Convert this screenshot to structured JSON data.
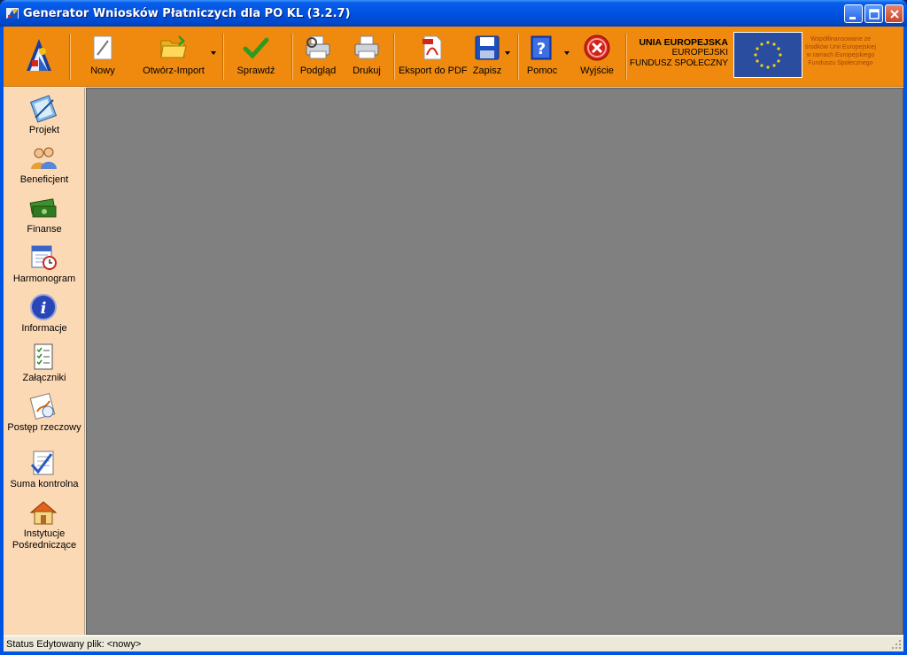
{
  "window": {
    "title": "Generator Wniosków Płatniczych dla PO KL (3.2.7)"
  },
  "toolbar": {
    "new_label": "Nowy",
    "open_label": "Otwórz-Import",
    "check_label": "Sprawdź",
    "preview_label": "Podgląd",
    "print_label": "Drukuj",
    "pdf_label": "Eksport do PDF",
    "save_label": "Zapisz",
    "help_label": "Pomoc",
    "exit_label": "Wyjście"
  },
  "eu": {
    "line1": "UNIA EUROPEJSKA",
    "line2": "EUROPEJSKI",
    "line3": "FUNDUSZ SPOŁECZNY",
    "note": "Współfinansowane ze środków Unii Europejskiej w ramach Europejskiego Funduszu Społecznego"
  },
  "sidebar": {
    "items": [
      {
        "label": "Projekt",
        "icon": "project-icon"
      },
      {
        "label": "Beneficjent",
        "icon": "beneficiary-icon"
      },
      {
        "label": "Finanse",
        "icon": "money-icon"
      },
      {
        "label": "Harmonogram",
        "icon": "schedule-icon"
      },
      {
        "label": "Informacje",
        "icon": "info-icon"
      },
      {
        "label": "Załączniki",
        "icon": "attachments-icon"
      },
      {
        "label": "Postęp rzeczowy",
        "icon": "progress-icon"
      },
      {
        "label": "Suma kontrolna",
        "icon": "checksum-icon"
      },
      {
        "label": "Instytucje Pośredniczące",
        "icon": "institutions-icon"
      }
    ]
  },
  "status": {
    "text": "Status  Edytowany plik: <nowy>"
  },
  "colors": {
    "toolbar": "#f08a0e",
    "sidebar": "#fcd9b5",
    "workspace": "#808080",
    "titlebar": "#0054e3"
  }
}
